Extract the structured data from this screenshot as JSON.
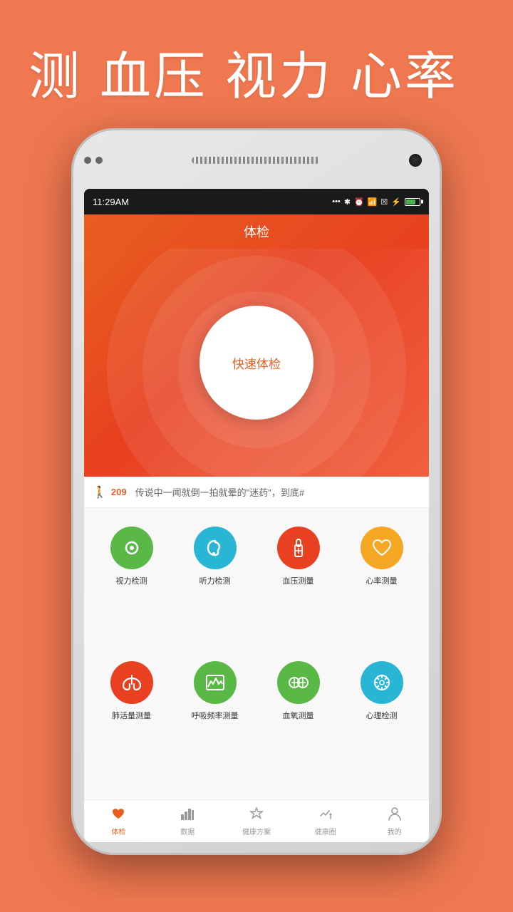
{
  "hero": {
    "title": "测 血压 视力 心率"
  },
  "phone": {
    "status_bar": {
      "time": "11:29AM",
      "icons": [
        "...",
        "bluetooth",
        "alarm",
        "wifi",
        "signal",
        "battery"
      ]
    },
    "app_header": {
      "title": "体检"
    },
    "center_button": {
      "label": "快速体检"
    },
    "news_bar": {
      "steps_icon": "🚶",
      "steps_count": "209",
      "news_text": "传说中一闻就倒一拍就晕的\"迷药\"，到底#"
    },
    "features_row1": [
      {
        "id": "vision",
        "label": "视力检测",
        "color": "fc-green",
        "icon": "👁"
      },
      {
        "id": "hearing",
        "label": "听力检测",
        "color": "fc-blue",
        "icon": "👂"
      },
      {
        "id": "blood_pressure",
        "label": "血压测量",
        "color": "fc-red",
        "icon": "🌡"
      },
      {
        "id": "heart_rate",
        "label": "心率测量",
        "color": "fc-orange",
        "icon": "♥"
      }
    ],
    "features_row2": [
      {
        "id": "lung",
        "label": "肺活量测量",
        "color": "fc-red",
        "icon": "⊙"
      },
      {
        "id": "breathing",
        "label": "呼吸频率测量",
        "color": "fc-green",
        "icon": "📊"
      },
      {
        "id": "blood_oxygen",
        "label": "血氧测量",
        "color": "fc-green",
        "icon": "⊕"
      },
      {
        "id": "psychology",
        "label": "心理检测",
        "color": "fc-blue",
        "icon": "⚙"
      }
    ],
    "bottom_nav": [
      {
        "id": "exam",
        "label": "体检",
        "active": true
      },
      {
        "id": "data",
        "label": "数据",
        "active": false
      },
      {
        "id": "health_plan",
        "label": "健康方案",
        "active": false
      },
      {
        "id": "health_circle",
        "label": "健康圈",
        "active": false
      },
      {
        "id": "mine",
        "label": "我的",
        "active": false
      }
    ]
  }
}
